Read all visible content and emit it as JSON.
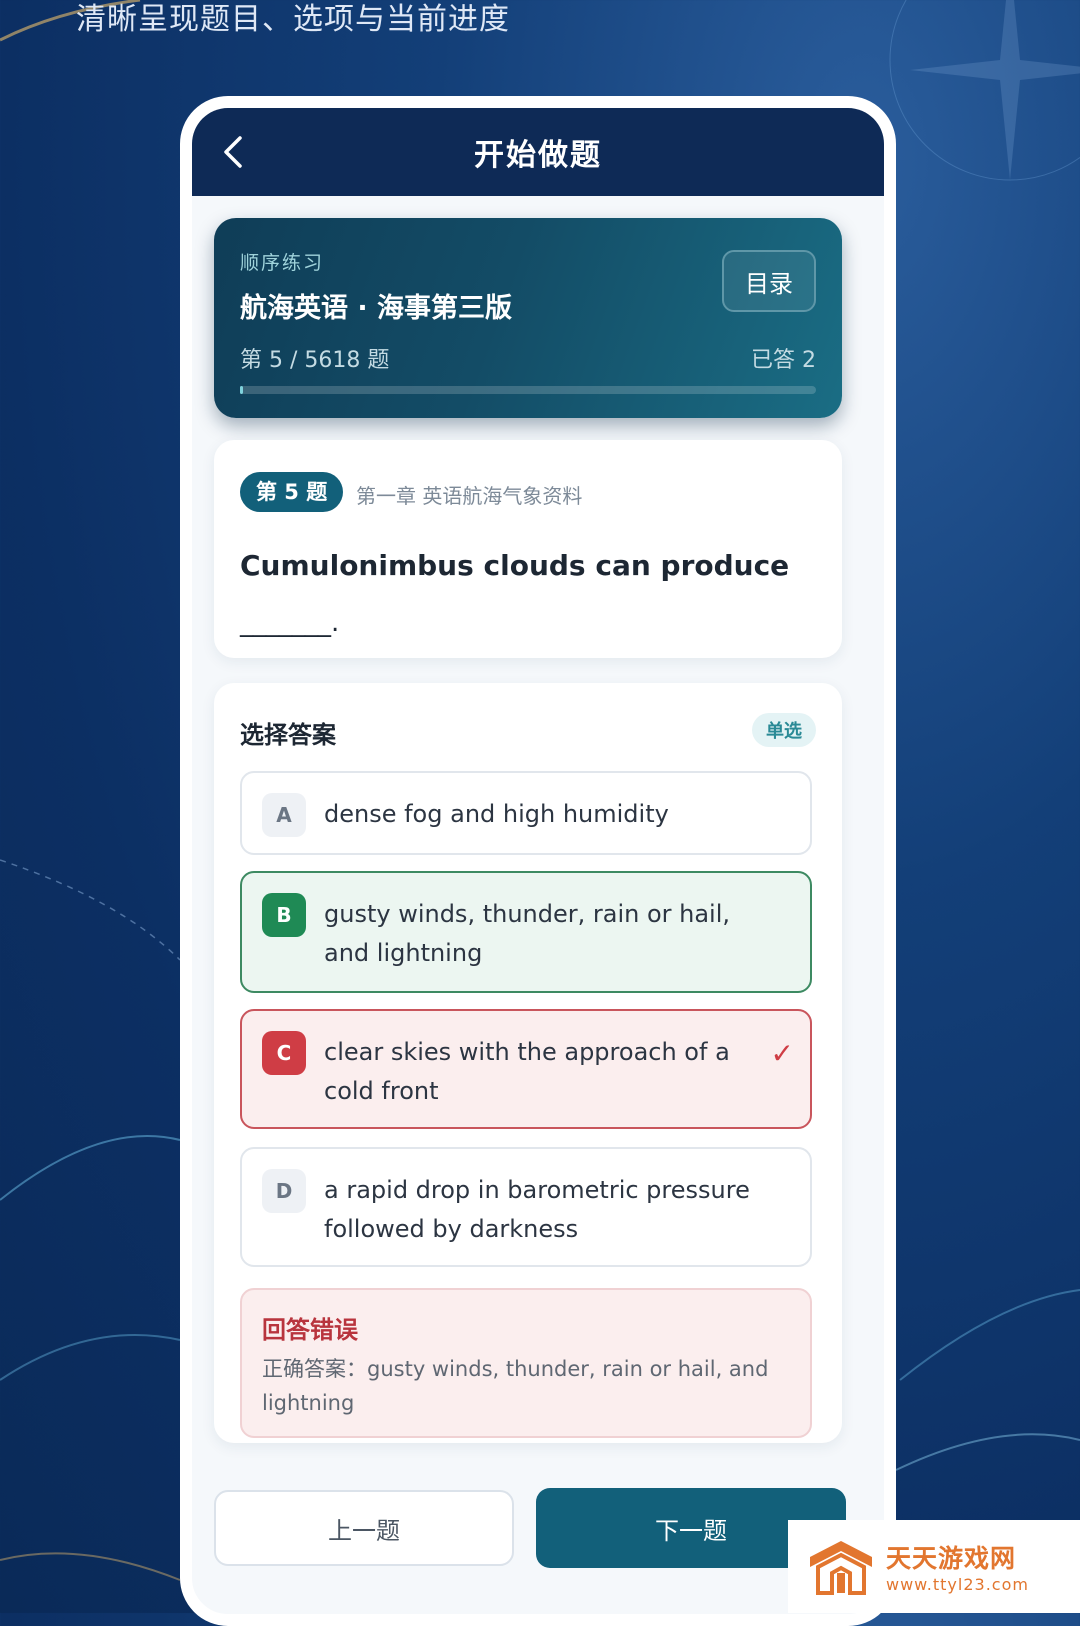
{
  "caption": "清晰呈现题目、选项与当前进度",
  "topbar": {
    "title": "开始做题"
  },
  "header": {
    "mode_label": "顺序练习",
    "book_title": "航海英语 · 海事第三版",
    "progress_text": "第 5 / 5618 题",
    "answered_text": "已答 2",
    "catalog_label": "目录",
    "progress_fraction": 0.00089
  },
  "question": {
    "badge": "第 5 题",
    "chapter": "第一章 英语航海气象资料",
    "text": "Cumulonimbus clouds can produce",
    "blank": "_______."
  },
  "answers": {
    "heading": "选择答案",
    "type_label": "单选",
    "options": [
      {
        "letter": "A",
        "text": "dense fog and high humidity",
        "state": "normal"
      },
      {
        "letter": "B",
        "text": "gusty winds, thunder, rain or hail, and lightning",
        "state": "correct"
      },
      {
        "letter": "C",
        "text": "clear skies with the approach of a cold front",
        "state": "wrong",
        "mark": "✓"
      },
      {
        "letter": "D",
        "text": "a rapid drop in barometric pressure followed by darkness",
        "state": "normal"
      }
    ],
    "result_title": "回答错误",
    "result_text": "正确答案：gusty winds, thunder, rain or hail, and lightning"
  },
  "nav": {
    "prev_label": "上一题",
    "next_label": "下一题"
  },
  "watermark": {
    "title": "天天游戏网",
    "url": "www.ttyl23.com"
  },
  "colors": {
    "primary": "#12607a",
    "correct": "#1f8a55",
    "wrong": "#cf3d45",
    "watermark": "#e2762f"
  }
}
